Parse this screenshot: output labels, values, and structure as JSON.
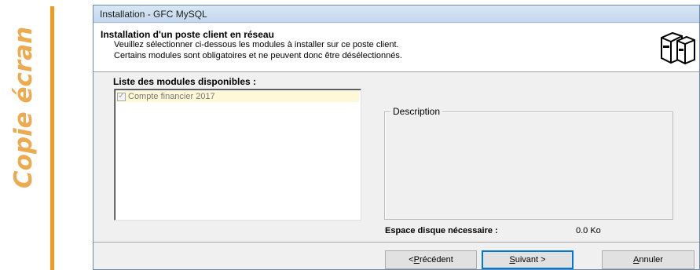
{
  "side_caption": "Copie écran",
  "window": {
    "title": "Installation - GFC MySQL"
  },
  "header": {
    "title": "Installation d'un poste client en réseau",
    "line1": "Veuillez sélectionner ci-dessous les modules à installer sur ce poste client.",
    "line2": "Certains modules sont obligatoires et ne peuvent donc être désélectionnés.",
    "icon": "computers-icon"
  },
  "modules": {
    "label": "Liste des modules disponibles :",
    "items": [
      {
        "label": "Compte financier 2017",
        "checked": true,
        "disabled": true
      }
    ]
  },
  "description": {
    "legend": "Description",
    "text": ""
  },
  "disk": {
    "label": "Espace disque nécessaire :",
    "value": "0.0 Ko"
  },
  "buttons": {
    "prev": {
      "prefix": "< ",
      "accel": "P",
      "rest": "récédent"
    },
    "next": {
      "accel": "S",
      "rest": "uivant >"
    },
    "cancel": {
      "accel": "A",
      "rest": "nnuler"
    }
  },
  "colors": {
    "caption": "#ecab50",
    "orange_bar": "#f39a1f",
    "selected_item_bg": "#fff8d6",
    "default_button_border": "#0078d7"
  }
}
